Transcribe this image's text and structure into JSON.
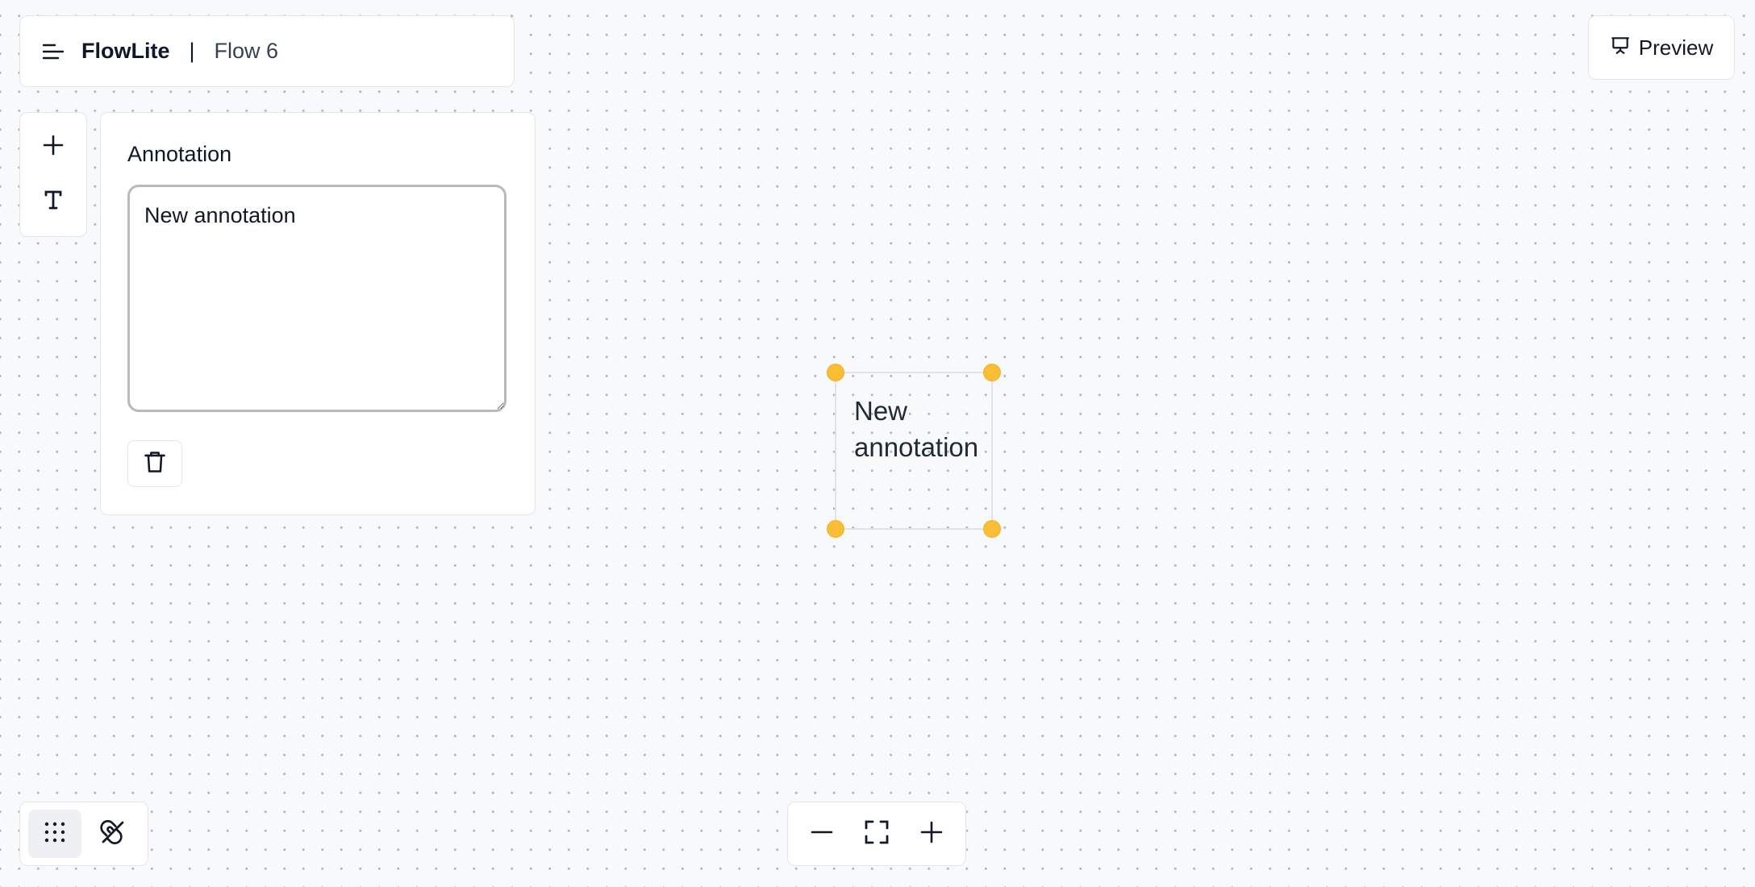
{
  "header": {
    "menu_icon": "menu-icon",
    "brand": "FlowLite",
    "separator": "|",
    "flow_name": "Flow 6"
  },
  "preview": {
    "icon": "presentation-icon",
    "label": "Preview"
  },
  "toolbar": {
    "items": [
      {
        "icon": "plus-icon"
      },
      {
        "icon": "text-icon"
      }
    ]
  },
  "annotation_panel": {
    "title": "Annotation",
    "text_value": "New annotation",
    "delete_icon": "trash-icon"
  },
  "canvas": {
    "annotation_text": "New annotation",
    "handle_color": "#f9bd36"
  },
  "bottom_left_tools": [
    {
      "icon": "grid-dots-icon",
      "active": true
    },
    {
      "icon": "magnet-off-icon",
      "active": false
    }
  ],
  "zoom_controls": [
    {
      "icon": "minus-icon"
    },
    {
      "icon": "fit-view-icon"
    },
    {
      "icon": "plus-icon"
    }
  ]
}
